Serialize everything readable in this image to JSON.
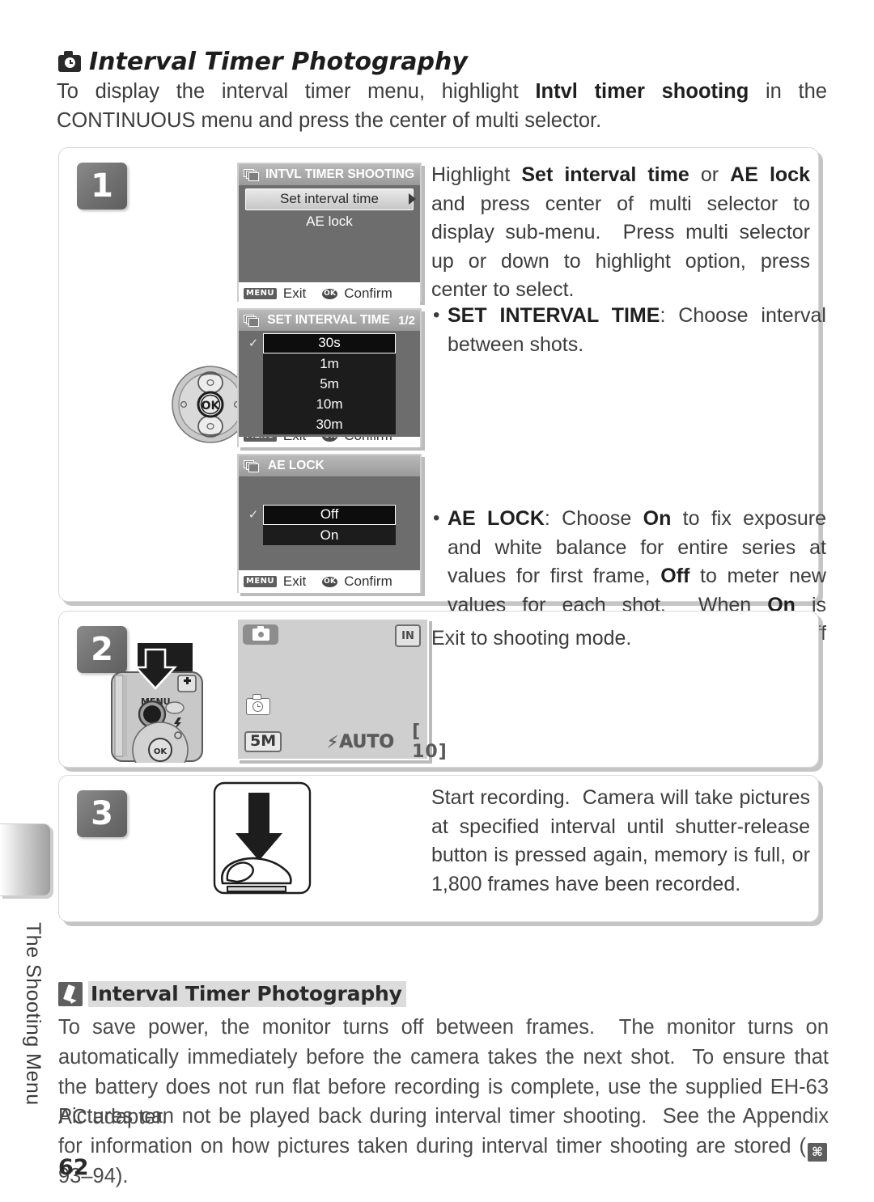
{
  "document": {
    "page_number": "62",
    "side_tab_label": "The Shooting Menu"
  },
  "header": {
    "icon": "camera-clock-icon",
    "title": "Interval Timer Photography",
    "intro_html": "To display the interval timer menu, highlight <b>Intvl timer shooting</b> in the CONTINUOUS menu and press the center of multi selector."
  },
  "steps": [
    {
      "number": "1",
      "illustration": "multi-selector-diagram",
      "screens": [
        {
          "id": "intvl-timer-shooting",
          "title": "INTVL TIMER SHOOTING",
          "page_indicator": "",
          "items": [
            {
              "label": "Set interval time",
              "selected": true,
              "has_submenu_arrow": true
            },
            {
              "label": "AE lock",
              "selected": false,
              "has_submenu_arrow": false
            }
          ],
          "footer": {
            "menu_chip": "MENU",
            "exit_label": "Exit",
            "ok_chip": "OK",
            "confirm_label": "Confirm"
          }
        },
        {
          "id": "set-interval-time",
          "title": "SET INTERVAL TIME",
          "page_indicator": "1/2",
          "options": [
            {
              "label": "30s",
              "selected": true,
              "checked": true
            },
            {
              "label": "1m",
              "selected": false,
              "checked": false
            },
            {
              "label": "5m",
              "selected": false,
              "checked": false
            },
            {
              "label": "10m",
              "selected": false,
              "checked": false
            },
            {
              "label": "30m",
              "selected": false,
              "checked": false
            }
          ],
          "footer": {
            "menu_chip": "MENU",
            "exit_label": "Exit",
            "ok_chip": "OK",
            "confirm_label": "Confirm"
          }
        },
        {
          "id": "ae-lock",
          "title": "AE LOCK",
          "page_indicator": "",
          "options": [
            {
              "label": "Off",
              "selected": true,
              "checked": true
            },
            {
              "label": "On",
              "selected": false,
              "checked": false
            }
          ],
          "footer": {
            "menu_chip": "MENU",
            "exit_label": "Exit",
            "ok_chip": "OK",
            "confirm_label": "Confirm"
          }
        }
      ],
      "text_html": "Highlight <b>Set interval time</b> or <b>AE lock</b> and press center of multi selector to display sub-menu.&nbsp; Press multi selector up or down to highlight option, press center to select.",
      "bullets_html": [
        "<b>SET INTERVAL TIME</b>: Choose interval between shots.",
        "<b>AE LOCK</b>: Choose <b>On</b> to fix exposure and white balance for entire series at values for first frame, <b>Off</b> to meter new values for each shot.&nbsp; When <b>On</b> is selected for <b>AE lock</b>, flash turns off automatically."
      ]
    },
    {
      "number": "2",
      "illustration": "camera-back-menu-button",
      "live_view": {
        "mode_icon": "camera-mode-icon",
        "memory_indicator": "IN",
        "interval_timer_icon": "interval-timer-icon",
        "image_size": "5M",
        "flash_mode": "AUTO",
        "frames_remaining": "[ 10]"
      },
      "text_html": "Exit to shooting mode."
    },
    {
      "number": "3",
      "illustration": "shutter-release-press",
      "text_html": "Start recording.&nbsp; Camera will take pictures at specified interval until shutter-release button is pressed again, memory is full, or 1,800 frames have been recorded."
    }
  ],
  "note": {
    "icon": "pencil-note-icon",
    "title": "Interval Timer Photography",
    "paragraph_1_html": "To save power, the monitor turns off between frames.&nbsp; The monitor turns on automatically immediately before the camera takes the next shot.&nbsp; To ensure that the battery does not run flat before recording is complete, use the supplied EH-63 AC adapter.",
    "paragraph_2_html": "Pictures can not be played back during interval timer shooting.&nbsp; See the Appendix for information on how pictures taken during interval timer shooting are stored (<span class=\"ref-icon\">⌘</span> 93–94)."
  },
  "colors": {
    "badge_gray": "#6f6f6f",
    "lcd_background": "#6d6d6d",
    "option_dark": "#1c1c1c",
    "text": "#3d3d3d",
    "note_highlight": "#dcdcdc"
  }
}
